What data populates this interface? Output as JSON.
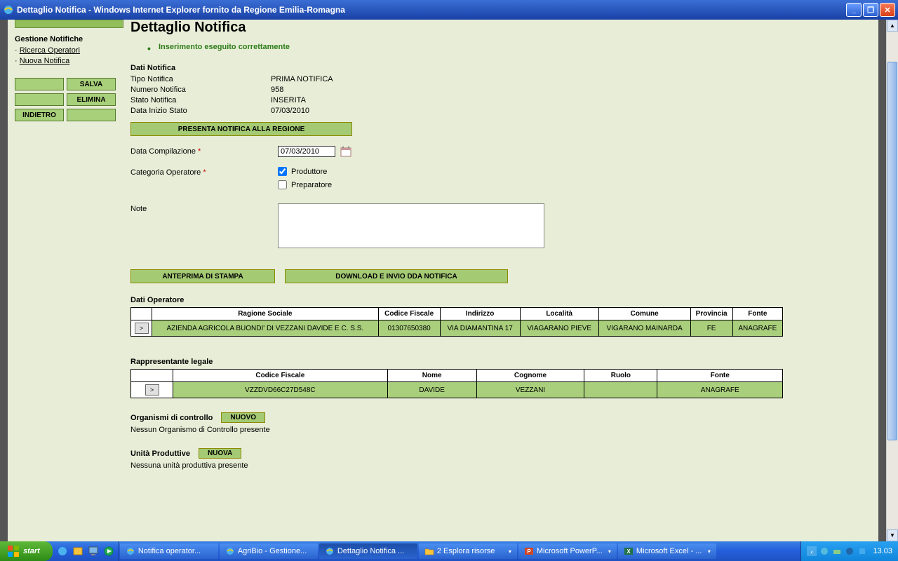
{
  "window": {
    "title": "Dettaglio Notifica - Windows Internet Explorer fornito da Regione Emilia-Romagna"
  },
  "sidebar": {
    "heading": "Gestione Notifiche",
    "links": [
      "Ricerca Operatori",
      "Nuova Notifica"
    ],
    "buttons": {
      "salva": "SALVA",
      "elimina": "ELIMINA",
      "indietro": "INDIETRO"
    }
  },
  "main": {
    "title": "Dettaglio Notifica",
    "success_msg": "Inserimento eseguito correttamente",
    "dati_notifica": {
      "heading": "Dati Notifica",
      "rows": [
        {
          "k": "Tipo Notifica",
          "v": "PRIMA NOTIFICA"
        },
        {
          "k": "Numero Notifica",
          "v": "958"
        },
        {
          "k": "Stato Notifica",
          "v": "INSERITA"
        },
        {
          "k": "Data Inizio Stato",
          "v": "07/03/2010"
        }
      ]
    },
    "presenta_btn": "PRESENTA NOTIFICA ALLA REGIONE",
    "data_compilazione": {
      "label": "Data Compilazione",
      "value": "07/03/2010"
    },
    "categoria": {
      "label": "Categoria Operatore",
      "options": [
        {
          "label": "Produttore",
          "checked": true
        },
        {
          "label": "Preparatore",
          "checked": false
        }
      ]
    },
    "note_label": "Note",
    "note_value": "",
    "anteprima_btn": "ANTEPRIMA DI STAMPA",
    "download_btn": "DOWNLOAD E INVIO DDA NOTIFICA",
    "dati_operatore": {
      "heading": "Dati Operatore",
      "headers": [
        "",
        "Ragione Sociale",
        "Codice Fiscale",
        "Indirizzo",
        "Località",
        "Comune",
        "Provincia",
        "Fonte"
      ],
      "row": {
        "ragione": "AZIENDA AGRICOLA BUONDI' DI VEZZANI DAVIDE E C. S.S.",
        "cf": "01307650380",
        "indirizzo": "VIA DIAMANTINA 17",
        "localita": "VIAGARANO PIEVE",
        "comune": "VIGARANO MAINARDA",
        "prov": "FE",
        "fonte": "ANAGRAFE"
      }
    },
    "rappresentante": {
      "heading": "Rappresentante legale",
      "headers": [
        "",
        "Codice Fiscale",
        "Nome",
        "Cognome",
        "Ruolo",
        "Fonte"
      ],
      "row": {
        "cf": "VZZDVD66C27D548C",
        "nome": "DAVIDE",
        "cognome": "VEZZANI",
        "ruolo": "",
        "fonte": "ANAGRAFE"
      }
    },
    "organismi": {
      "heading": "Organismi di controllo",
      "btn": "NUOVO",
      "msg": "Nessun Organismo di Controllo presente"
    },
    "unita": {
      "heading": "Unità Produttive",
      "btn": "NUOVA",
      "msg": "Nessuna unità produttiva presente"
    }
  },
  "taskbar": {
    "start": "start",
    "items": [
      {
        "label": "Notifica operator...",
        "icon": "ie"
      },
      {
        "label": "AgriBio - Gestione...",
        "icon": "ie"
      },
      {
        "label": "Dettaglio Notifica ...",
        "icon": "ie",
        "active": true
      },
      {
        "label": "2 Esplora risorse",
        "icon": "folder",
        "drop": true
      },
      {
        "label": "Microsoft PowerP...",
        "icon": "ppt",
        "drop": true
      },
      {
        "label": "Microsoft Excel - ...",
        "icon": "xls",
        "drop": true
      }
    ],
    "clock": "13.03"
  },
  "select_btn": ">"
}
